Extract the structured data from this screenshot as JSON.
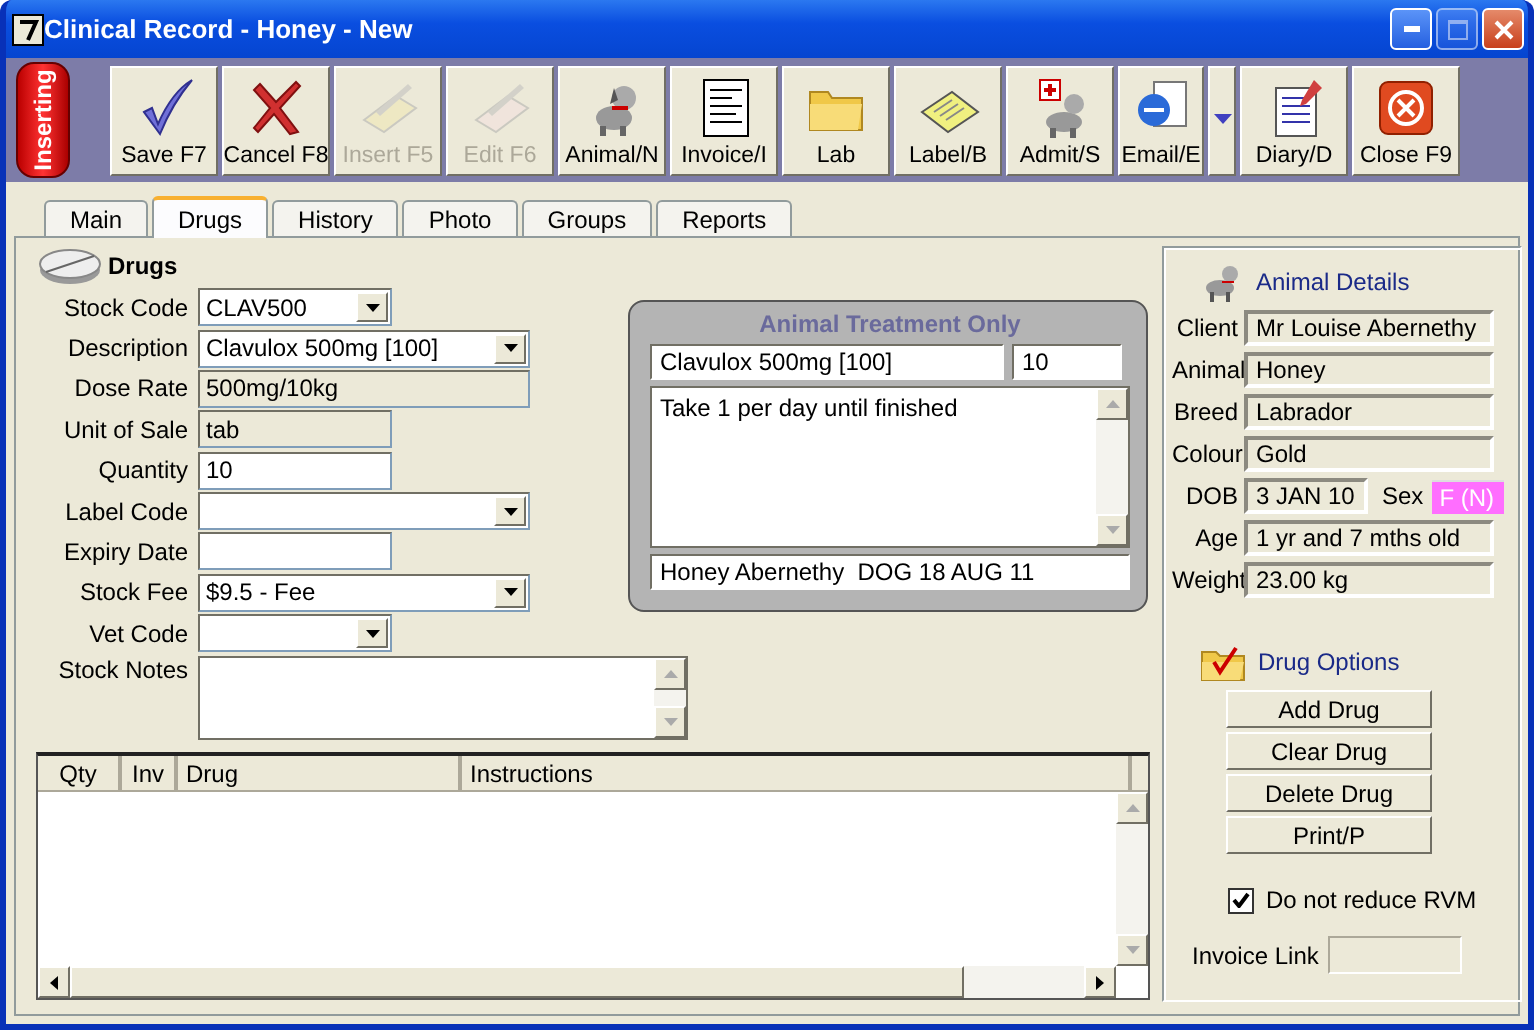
{
  "window": {
    "title": "Clinical Record - Honey - New"
  },
  "mode_badge": "Inserting",
  "toolbar": [
    {
      "kind": "save",
      "label": "Save F7",
      "disabled": false
    },
    {
      "kind": "cancel",
      "label": "Cancel F8",
      "disabled": false
    },
    {
      "kind": "insert",
      "label": "Insert F5",
      "disabled": true
    },
    {
      "kind": "edit",
      "label": "Edit F6",
      "disabled": true
    },
    {
      "kind": "animal",
      "label": "Animal/N",
      "disabled": false
    },
    {
      "kind": "invoice",
      "label": "Invoice/I",
      "disabled": false
    },
    {
      "kind": "lab",
      "label": "Lab",
      "disabled": false
    },
    {
      "kind": "label",
      "label": "Label/B",
      "disabled": false
    },
    {
      "kind": "admit",
      "label": "Admit/S",
      "disabled": false
    },
    {
      "kind": "email",
      "label": "Email/E",
      "disabled": false
    },
    {
      "kind": "dropdown",
      "disabled": false
    },
    {
      "kind": "diary",
      "label": "Diary/D",
      "disabled": false
    },
    {
      "kind": "close",
      "label": "Close F9",
      "disabled": false
    }
  ],
  "tabs": [
    {
      "label": "Main",
      "selected": false
    },
    {
      "label": "Drugs",
      "selected": true
    },
    {
      "label": "History",
      "selected": false
    },
    {
      "label": "Photo",
      "selected": false
    },
    {
      "label": "Groups",
      "selected": false
    },
    {
      "label": "Reports",
      "selected": false
    }
  ],
  "drugs": {
    "title": "Drugs",
    "fields": [
      {
        "label": "Stock Code",
        "kind": "combo",
        "value": "CLAV500"
      },
      {
        "label": "Description",
        "kind": "combo",
        "value": "Clavulox 500mg [100]"
      },
      {
        "label": "Dose Rate",
        "kind": "readonly",
        "value": "500mg/10kg"
      },
      {
        "label": "Unit of Sale",
        "kind": "readonly",
        "value": "tab"
      },
      {
        "label": "Quantity",
        "kind": "text",
        "value": "10"
      },
      {
        "label": "Label Code",
        "kind": "combo"
      },
      {
        "label": "Expiry Date",
        "kind": "text"
      },
      {
        "label": "Stock Fee",
        "kind": "combo",
        "value": "$9.5 - Fee"
      },
      {
        "label": "Vet Code",
        "kind": "combo"
      }
    ],
    "notes": {
      "label": "Stock Notes"
    }
  },
  "treatment": {
    "title": "Animal Treatment Only",
    "drug": "Clavulox 500mg [100]",
    "quantity": "10",
    "instructions": "Take 1 per day until finished",
    "label_line": "Honey Abernethy  DOG 18 AUG 11"
  },
  "table": {
    "columns": [
      "Qty",
      "Inv",
      "Drug",
      "Instructions"
    ]
  },
  "animal_details": {
    "title": "Animal Details",
    "fields": [
      {
        "kind": "single",
        "label": "Client",
        "value": "Mr Louise Abernethy"
      },
      {
        "kind": "single",
        "label": "Animal",
        "value": "Honey"
      },
      {
        "kind": "single",
        "label": "Breed",
        "value": "Labrador"
      },
      {
        "kind": "single",
        "label": "Colour",
        "value": "Gold"
      },
      {
        "kind": "pair",
        "label": "DOB",
        "value": "3 JAN 10",
        "label_2": "Sex",
        "value_2": "F (N)"
      },
      {
        "kind": "single",
        "label": "Age",
        "value": "1 yr and 7 mths old"
      },
      {
        "kind": "single",
        "label": "Weight",
        "value": "23.00 kg"
      }
    ]
  },
  "drug_options": {
    "title": "Drug Options",
    "buttons": [
      "Add Drug",
      "Clear Drug",
      "Delete Drug",
      "Print/P"
    ],
    "checkbox": {
      "label": "Do not reduce RVM",
      "checked": true
    },
    "invoice_link": {
      "label": "Invoice Link"
    }
  }
}
